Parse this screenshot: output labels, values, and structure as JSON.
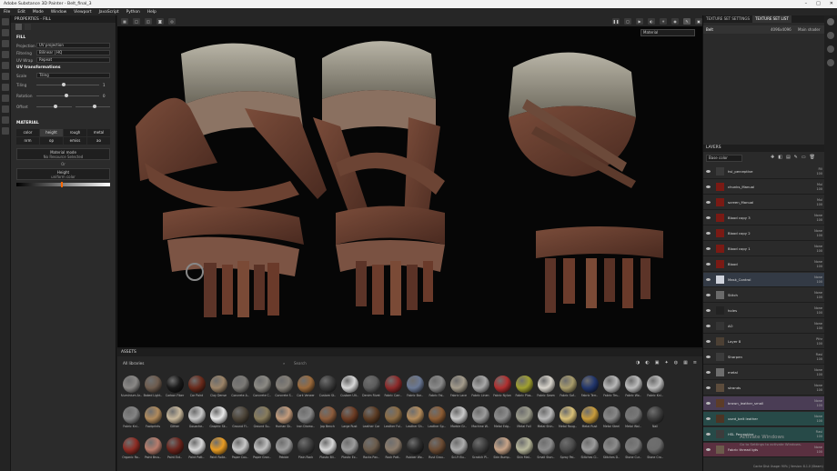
{
  "window": {
    "title": "Adobe Substance 3D Painter - Belt_final_3",
    "controls": [
      "–",
      "□",
      "✕"
    ]
  },
  "menu": [
    "File",
    "Edit",
    "Mode",
    "Window",
    "Viewport",
    "JavaScript",
    "Python",
    "Help"
  ],
  "properties": {
    "header": "PROPERTIES - FILL",
    "fill_title": "FILL",
    "projection_label": "Projection",
    "projection_value": "UV projection",
    "filtering_label": "Filtering",
    "filtering_value": "Bilinear | HQ",
    "uvwrap_label": "UV Wrap",
    "uvwrap_value": "Repeat",
    "uvtrans_title": "UV transformations",
    "scale_label": "Scale",
    "scale_value": "Tiling",
    "tiling_label": "Tiling",
    "tiling_value": "1",
    "rotation_label": "Rotation",
    "rotation_value": "0",
    "offset_label": "Offset",
    "material_title": "MATERIAL",
    "channels": [
      "color",
      "height",
      "rough",
      "metal",
      "nrm",
      "op",
      "emiss",
      "ao"
    ],
    "channel_active": "height",
    "mode_label": "Material mode",
    "mode_value": "No Resource Selected",
    "or_text": "Or",
    "height_label": "Height",
    "height_value": "uniform color"
  },
  "viewport": {
    "dropdown": "Material"
  },
  "assets": {
    "header": "ASSETS",
    "filter": "All libraries",
    "search_placeholder": "Search",
    "materials": [
      [
        "Aluminium Ar..",
        "#8a8886"
      ],
      [
        "Baked Light..",
        "#6e5c4e"
      ],
      [
        "Carbon Fiber",
        "#1a1a1a"
      ],
      [
        "Car Paint",
        "#6a2b1c"
      ],
      [
        "Clay Dense",
        "#9c8468"
      ],
      [
        "Concrete A..",
        "#7c7a76"
      ],
      [
        "Concrete C..",
        "#8c8a84"
      ],
      [
        "Concrete S..",
        "#858078"
      ],
      [
        "Cork Veneer",
        "#9a6a3c"
      ],
      [
        "Custom St..",
        "#3a3a3a"
      ],
      [
        "Custom Ult..",
        "#d8d8d8"
      ],
      [
        "Denim Rivet",
        "#5c5c5c"
      ],
      [
        "Fabric Carr..",
        "#8c2a2a"
      ],
      [
        "Fabric Bar..",
        "#6a7894"
      ],
      [
        "Fabric Fal..",
        "#8a8a8a"
      ],
      [
        "Fabric Lace",
        "#a49c8c"
      ],
      [
        "Fabric Linen",
        "#a8a8a8"
      ],
      [
        "Fabric Nylon",
        "#b03030"
      ],
      [
        "Fabric Plas..",
        "#a0a030"
      ],
      [
        "Fabric Seam",
        "#d8d4cc"
      ],
      [
        "Fabric Sof..",
        "#a89c6c"
      ],
      [
        "Fabric Terr..",
        "#22366c"
      ],
      [
        "Fabric Tes..",
        "#b8b8b8"
      ],
      [
        "Fabric Wo..",
        "#bcbcbc"
      ],
      [
        "Fabric Kni..",
        "#bcbcbc"
      ],
      [
        "Fabric Kni..",
        "#848484"
      ],
      [
        "Footprints",
        "#b08a5c"
      ],
      [
        "Glitter",
        "#c8b89c"
      ],
      [
        "Gouache..",
        "#c8c8c8"
      ],
      [
        "Graphic Sk..",
        "#e8e8e8"
      ],
      [
        "Ground Fl..",
        "#4c4438"
      ],
      [
        "Ground Su..",
        "#887c5c"
      ],
      [
        "Human Sk..",
        "#c49c7c"
      ],
      [
        "Iron Diamo..",
        "#888888"
      ],
      [
        "Jap Bench",
        "#8c5c3c"
      ],
      [
        "Large Rust",
        "#6c3c24"
      ],
      [
        "Leather Car",
        "#5c3c24"
      ],
      [
        "Leather Ful..",
        "#8c6c44"
      ],
      [
        "Leather Sh..",
        "#b48c5c"
      ],
      [
        "Leather Sp..",
        "#8c5c34"
      ],
      [
        "Marble Gr..",
        "#c8c8c8"
      ],
      [
        "Machine W..",
        "#9c9c9c"
      ],
      [
        "Metal Edg..",
        "#8c8c8c"
      ],
      [
        "Metal Foil",
        "#9c9c8c"
      ],
      [
        "Metal Shin..",
        "#b8b8b8"
      ],
      [
        "Metal Roug..",
        "#d8c078"
      ],
      [
        "Metal Rust",
        "#c89c3c"
      ],
      [
        "Metal Steel",
        "#888888"
      ],
      [
        "Metal Wal..",
        "#787878"
      ],
      [
        "Nail",
        "#3c3c3c"
      ],
      [
        "Organic Ro..",
        "#8c2c24"
      ],
      [
        "Paint Brus..",
        "#b87c6c"
      ],
      [
        "Paint Ext..",
        "#6c241c"
      ],
      [
        "Paint Patt..",
        "#d8d8d8"
      ],
      [
        "Paint Rolle..",
        "#e89c24"
      ],
      [
        "Paper Cou..",
        "#c8c8c8"
      ],
      [
        "Paper Gran..",
        "#c0c0c0"
      ],
      [
        "Pebble",
        "#9c9c9c"
      ],
      [
        "Plain Rock",
        "#3c3c3c"
      ],
      [
        "Plastic Bli..",
        "#d8d8d8"
      ],
      [
        "Plastic Ex..",
        "#9c9c9c"
      ],
      [
        "Rocks Pav..",
        "#6c5c4c"
      ],
      [
        "Rock Patt..",
        "#8c7c6c"
      ],
      [
        "Rubber Wo..",
        "#2c2c2c"
      ],
      [
        "Rust Grou..",
        "#6c4c34"
      ],
      [
        "Sci-Fi Bu..",
        "#acacac"
      ],
      [
        "Scratch Pl..",
        "#3c3c3c"
      ],
      [
        "Skin Bump..",
        "#c8a488"
      ],
      [
        "Skin Mat..",
        "#b8b89c"
      ],
      [
        "Small Ston..",
        "#8c8c8c"
      ],
      [
        "Spray Pai..",
        "#4c4c4c"
      ],
      [
        "Stitches Cl..",
        "#9c9c9c"
      ],
      [
        "Stitches D..",
        "#8c8c8c"
      ],
      [
        "Stone Cur..",
        "#7c7c7c"
      ],
      [
        "Stone Cro..",
        "#6c6c6c"
      ]
    ]
  },
  "texture_set": {
    "tab1": "TEXTURE SET SETTINGS",
    "tab2": "TEXTURE SET LIST",
    "name": "Belt",
    "size": "4096x4096",
    "shader": "Main shader"
  },
  "layers": {
    "header": "LAYERS",
    "channel": "Base color",
    "items": [
      [
        "hsl_perceptive",
        "Fill",
        "100",
        "#2a2a2a",
        "#3a3a3a"
      ],
      [
        "chunks_Manual",
        "Mul",
        "100",
        "#2a2a2a",
        "#7a1a14"
      ],
      [
        "screen_Manual",
        "Mul",
        "100",
        "#2a2a2a",
        "#7a1a14"
      ],
      [
        "Blood copy 3",
        "None",
        "100",
        "#2a2a2a",
        "#7a1a14"
      ],
      [
        "Blood copy 2",
        "None",
        "100",
        "#2a2a2a",
        "#7a1a14"
      ],
      [
        "Blood copy 1",
        "None",
        "100",
        "#2a2a2a",
        "#7a1a14"
      ],
      [
        "Blood",
        "None",
        "100",
        "#2a2a2a",
        "#7a1a14"
      ],
      [
        "Mask_Control",
        "None",
        "100",
        "#333a45",
        "#cfd3dc"
      ],
      [
        "Stitch",
        "None",
        "100",
        "#2a2a2a",
        "#6a6a6a"
      ],
      [
        "holes",
        "None",
        "100",
        "#2a2a2a",
        "#222222"
      ],
      [
        "AO",
        "None",
        "100",
        "#2a2a2a",
        "#353535"
      ],
      [
        "Layer 8",
        "Pthr",
        "100",
        "#2a2a2a",
        "#4c4034"
      ],
      [
        "Sharpen",
        "Fiasl",
        "100",
        "#2a2a2a",
        "#3c3c3c"
      ],
      [
        "metal",
        "None",
        "100",
        "#2a2a2a",
        "#6e6e6e"
      ],
      [
        "strands",
        "None",
        "100",
        "#2a2a2a",
        "#5c4c3c"
      ],
      [
        "brown_leather_small",
        "None",
        "100",
        "#4a3d55",
        "#5c3c28"
      ],
      [
        "used_belt leather",
        "None",
        "100",
        "#274a48",
        "#4c3424"
      ],
      [
        "HSL Perceptive",
        "Fiasl",
        "100",
        "#274a48",
        "#3c3c3c"
      ],
      [
        "Fabric thread lgts",
        "None",
        "100",
        "#5a3040",
        "#6c5c4c"
      ]
    ]
  },
  "watermark": {
    "line1": "Activate Windows",
    "line2": "Go to Settings to activate Windows."
  },
  "status": "Cache Disk Usage: 90% | Version: 8.1.0 (Steam)"
}
